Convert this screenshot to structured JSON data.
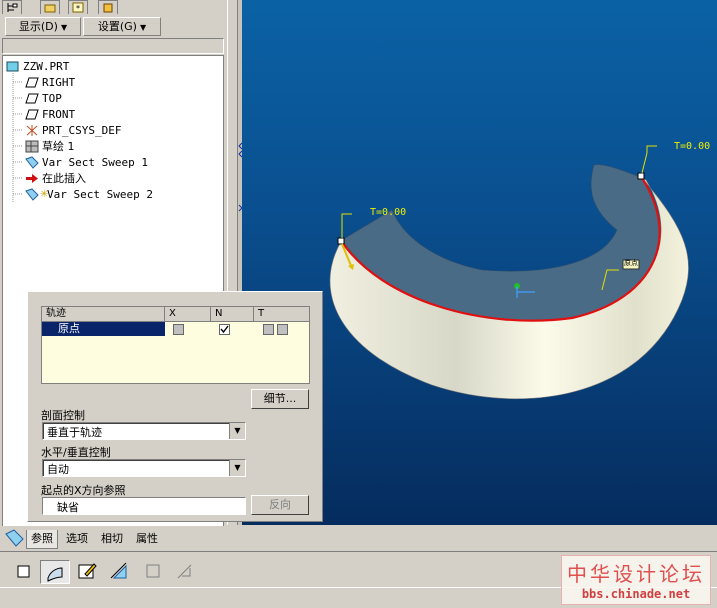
{
  "navigator": {
    "menu_show": "显示(D)",
    "menu_settings": "设置(G)",
    "tree": [
      {
        "label": "ZZW.PRT",
        "icon": "part-icon"
      },
      {
        "label": "RIGHT",
        "icon": "datum-plane-icon"
      },
      {
        "label": "TOP",
        "icon": "datum-plane-icon"
      },
      {
        "label": "FRONT",
        "icon": "datum-plane-icon"
      },
      {
        "label": "PRT_CSYS_DEF",
        "icon": "csys-icon"
      },
      {
        "label": "草绘 1",
        "icon": "sketch-icon"
      },
      {
        "label": "Var Sect Sweep 1",
        "icon": "sweep-icon"
      },
      {
        "label": "在此插入",
        "icon": "insert-here-arrow-icon"
      },
      {
        "label": "Var Sect Sweep 2",
        "icon": "sweep-icon"
      }
    ]
  },
  "viewport": {
    "label_t1": "T=0.00",
    "label_t2": "T=0.00",
    "label_origin": "原点",
    "colors": {
      "bg_top": "#0a62a5",
      "bg_bottom": "#052c5e",
      "trajectory": "#e01010",
      "surface_top": "#4a6b86"
    }
  },
  "dialog": {
    "grid": {
      "headers": [
        "轨迹",
        "X",
        "N",
        "T"
      ],
      "rows": [
        {
          "name": "原点",
          "x_checked": false,
          "n_checked": true,
          "t_checked": false
        }
      ]
    },
    "details_button": "细节...",
    "section_control_label": "剖面控制",
    "section_control_value": "垂直于轨迹",
    "hv_control_label": "水平/垂直控制",
    "hv_control_value": "自动",
    "start_x_label": "起点的X方向参照",
    "start_x_value": "缺省",
    "flip_button": "反向"
  },
  "lower_tabs": [
    "参照",
    "选项",
    "相切",
    "属性"
  ],
  "watermark": {
    "title": "中华设计论坛",
    "url": "bbs.chinade.net"
  }
}
